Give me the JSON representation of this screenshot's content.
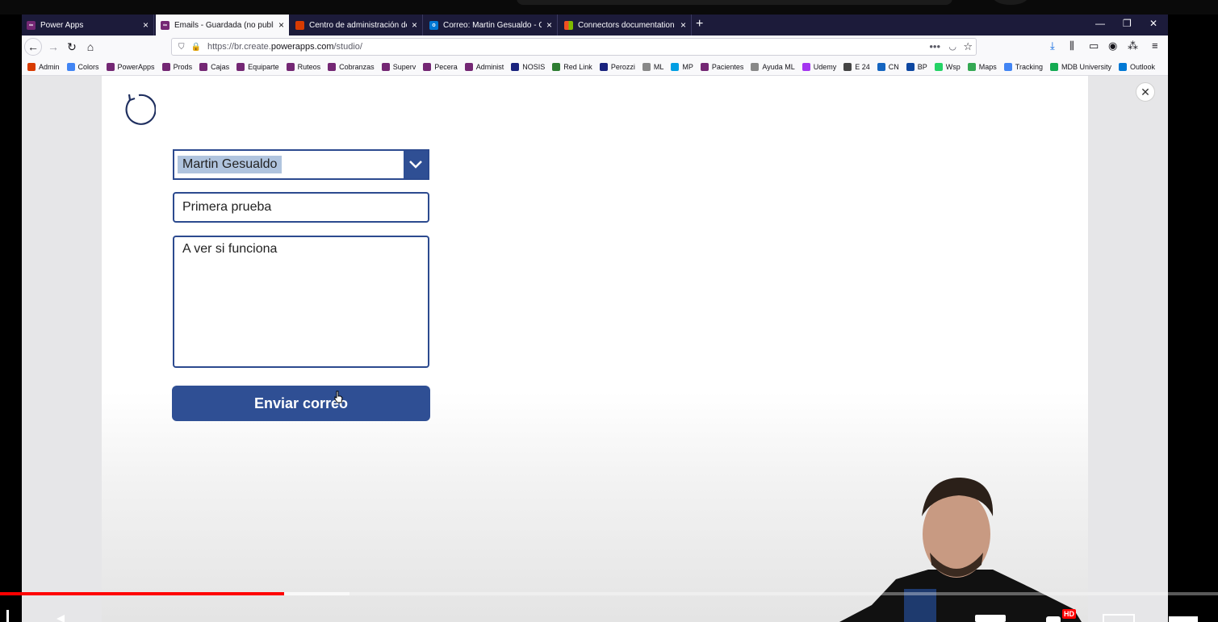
{
  "tabs": [
    {
      "title": "Power Apps",
      "icon": "powerapps-icon",
      "color": "#742774",
      "active": false
    },
    {
      "title": "Emails - Guardada (no publicad",
      "icon": "powerapps-icon",
      "color": "#742774",
      "active": true
    },
    {
      "title": "Centro de administración de M",
      "icon": "office-icon",
      "color": "#d83b01",
      "active": false
    },
    {
      "title": "Correo: Martin Gesualdo - Outl",
      "icon": "outlook-icon",
      "color": "#0078d4",
      "active": false
    },
    {
      "title": "Connectors documentation - C",
      "icon": "microsoft-icon",
      "color": "#f25022",
      "active": false
    }
  ],
  "url": {
    "prefix": "https://br.create.",
    "domain": "powerapps.com",
    "path": "/studio/"
  },
  "bookmarks": [
    {
      "label": "Admin",
      "color": "#d83b01"
    },
    {
      "label": "Colors",
      "color": "#4285f4"
    },
    {
      "label": "PowerApps",
      "color": "#742774"
    },
    {
      "label": "Prods",
      "color": "#742774"
    },
    {
      "label": "Cajas",
      "color": "#742774"
    },
    {
      "label": "Equiparte",
      "color": "#742774"
    },
    {
      "label": "Ruteos",
      "color": "#742774"
    },
    {
      "label": "Cobranzas",
      "color": "#742774"
    },
    {
      "label": "Superv",
      "color": "#742774"
    },
    {
      "label": "Pecera",
      "color": "#742774"
    },
    {
      "label": "Administ",
      "color": "#742774"
    },
    {
      "label": "NOSIS",
      "color": "#1a237e"
    },
    {
      "label": "Red Link",
      "color": "#2e7d32"
    },
    {
      "label": "Perozzi",
      "color": "#1a237e"
    },
    {
      "label": "ML",
      "color": "#888888"
    },
    {
      "label": "MP",
      "color": "#009ee3"
    },
    {
      "label": "Pacientes",
      "color": "#742774"
    },
    {
      "label": "Ayuda ML",
      "color": "#888888"
    },
    {
      "label": "Udemy",
      "color": "#a435f0"
    },
    {
      "label": "E 24",
      "color": "#444444"
    },
    {
      "label": "CN",
      "color": "#1565c0"
    },
    {
      "label": "BP",
      "color": "#0d47a1"
    },
    {
      "label": "Wsp",
      "color": "#25d366"
    },
    {
      "label": "Maps",
      "color": "#34a853"
    },
    {
      "label": "Tracking",
      "color": "#4285f4"
    },
    {
      "label": "MDB University",
      "color": "#13aa52"
    },
    {
      "label": "Outlook",
      "color": "#0078d4"
    }
  ],
  "form": {
    "recipient": "Martin Gesualdo",
    "subject": "Primera prueba",
    "body": "A ver si funciona",
    "send_label": "Enviar correo"
  },
  "player": {
    "progress": 0.233,
    "hd_label": "HD"
  },
  "colors": {
    "accent": "#2f4f94",
    "tabbar": "#1c1b3a",
    "progress": "#ff0000"
  }
}
